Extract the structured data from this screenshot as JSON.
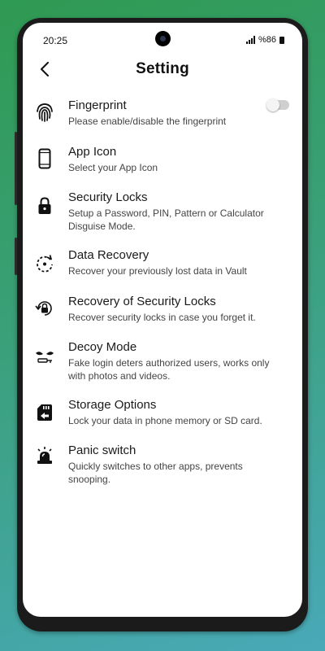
{
  "status_bar": {
    "time": "20:25",
    "battery": "%86"
  },
  "header": {
    "title": "Setting"
  },
  "settings": [
    {
      "label": "Fingerprint",
      "description": "Please enable/disable the fingerprint",
      "icon": "fingerprint-icon",
      "toggle_on": false
    },
    {
      "label": "App Icon",
      "description": "Select your App Icon",
      "icon": "phone-icon"
    },
    {
      "label": "Security Locks",
      "description": "Setup a Password, PIN, Pattern or Calculator Disguise Mode.",
      "icon": "lock-icon"
    },
    {
      "label": "Data Recovery",
      "description": "Recover your previously lost data in Vault",
      "icon": "restore-icon"
    },
    {
      "label": "Recovery of Security Locks",
      "description": "Recover security locks in case you forget it.",
      "icon": "lock-restore-icon"
    },
    {
      "label": "Decoy Mode",
      "description": "Fake login deters authorized users, works only with photos and videos.",
      "icon": "decoy-icon"
    },
    {
      "label": "Storage Options",
      "description": "Lock your data in phone memory or SD card.",
      "icon": "sd-card-icon"
    },
    {
      "label": "Panic switch",
      "description": "Quickly switches to other apps, prevents snooping.",
      "icon": "siren-icon"
    }
  ],
  "colors": {
    "background_start": "#2f9a52",
    "background_end": "#49a9b8",
    "toggle_off": "#cfcfcf"
  }
}
